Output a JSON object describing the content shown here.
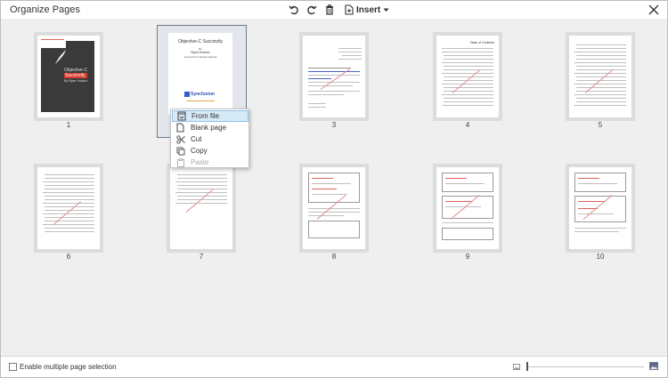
{
  "dialog": {
    "title": "Organize Pages",
    "toolbar": {
      "rotate_left_icon": "rotate-counterclockwise-icon",
      "rotate_right_icon": "rotate-clockwise-icon",
      "delete_icon": "trash-icon",
      "insert_label": "Insert",
      "insert_icon": "insert-page-icon"
    },
    "close_icon": "close-icon"
  },
  "pages": [
    {
      "number": "1"
    },
    {
      "number": "2",
      "selected": true,
      "title": "Objective-C Succinctly",
      "author_by": "By",
      "author": "Ryan Hodson",
      "foreword": "Foreword by Daniel Jebaraj",
      "brand": "Syncfusion"
    },
    {
      "number": "3"
    },
    {
      "number": "4",
      "title": "Table of Contents"
    },
    {
      "number": "5"
    },
    {
      "number": "6"
    },
    {
      "number": "7"
    },
    {
      "number": "8"
    },
    {
      "number": "9"
    },
    {
      "number": "10"
    }
  ],
  "cover": {
    "title_line1": "Objective-C",
    "title_line2": "Succinctly",
    "author": "By Ryan Hodson"
  },
  "context_menu": {
    "items": [
      {
        "label": "From file",
        "icon": "from-file-icon",
        "highlighted": true
      },
      {
        "label": "Blank page",
        "icon": "blank-page-icon"
      },
      {
        "label": "Cut",
        "icon": "scissors-icon"
      },
      {
        "label": "Copy",
        "icon": "copy-icon"
      },
      {
        "label": "Paste",
        "icon": "paste-icon",
        "disabled": true
      }
    ]
  },
  "footer": {
    "checkbox_label": "Enable multiple page selection",
    "checked": false,
    "zoom_out_icon": "small-image-icon",
    "zoom_in_icon": "large-image-icon",
    "zoom_level": 0
  },
  "colors": {
    "grid_background": "#efefef",
    "menu_highlight": "#d6eaf8",
    "selected_border": "#6b7a8c"
  }
}
